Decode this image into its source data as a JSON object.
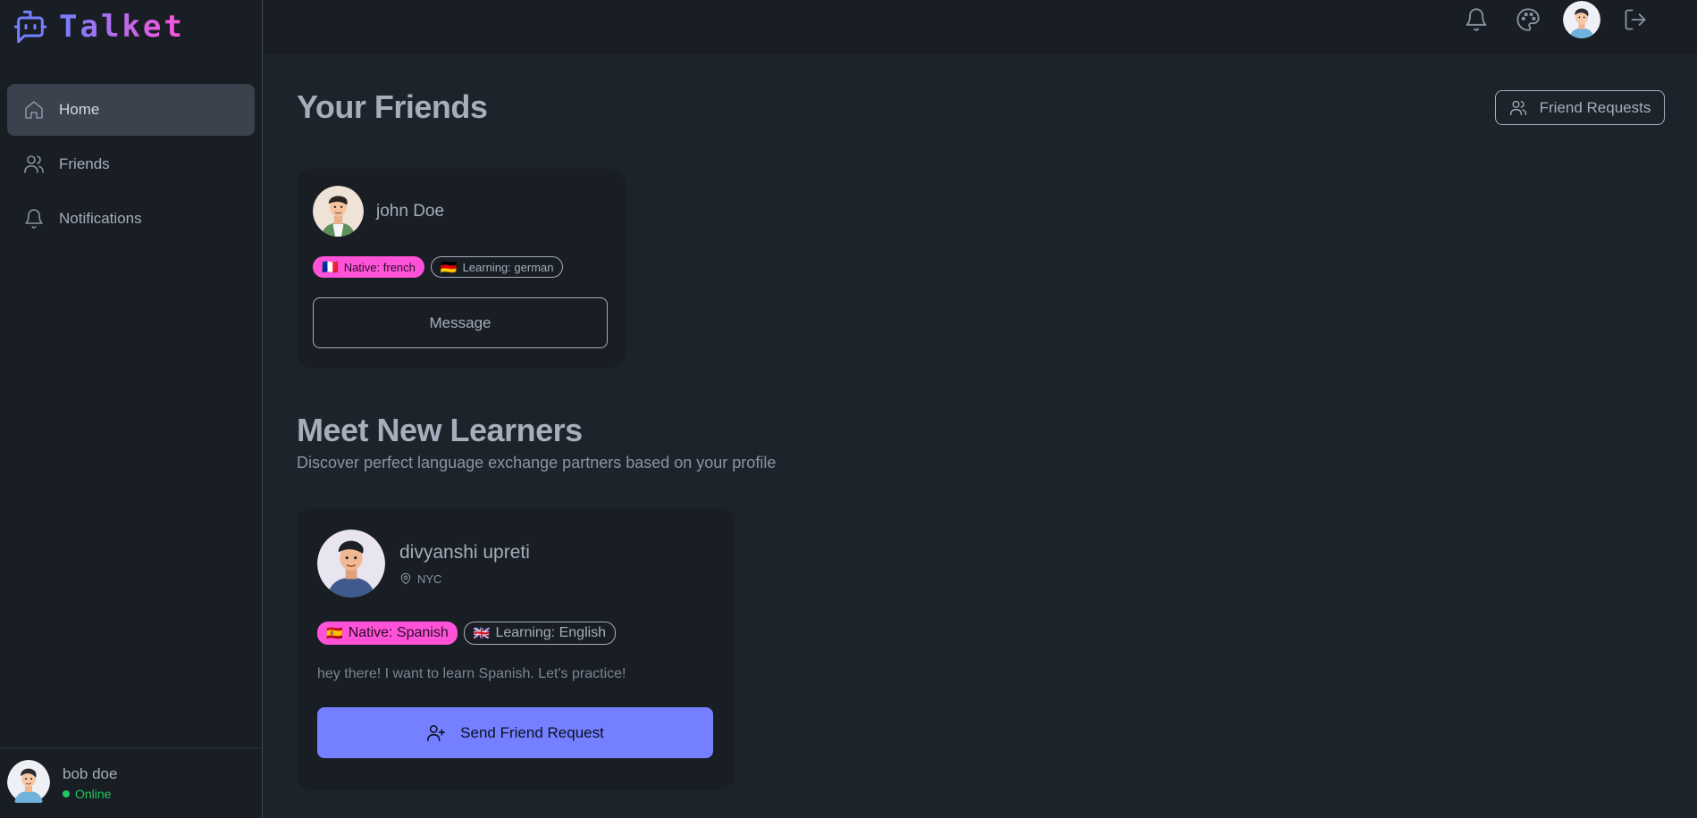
{
  "app": {
    "name": "Talket",
    "brand_color": "#7480ff"
  },
  "sidebar": {
    "items": [
      {
        "label": "Home",
        "icon": "home-icon"
      },
      {
        "label": "Friends",
        "icon": "users-icon"
      },
      {
        "label": "Notifications",
        "icon": "bell-icon"
      }
    ],
    "user": {
      "name": "bob doe",
      "status": "Online"
    }
  },
  "topbar": {
    "icons": [
      "bell-icon",
      "palette-icon",
      "avatar",
      "logout-icon"
    ]
  },
  "friends_section": {
    "title": "Your Friends",
    "requests_button": "Friend Requests",
    "friends": [
      {
        "name": "john Doe",
        "native": "Native: french",
        "native_flag": "🇫🇷",
        "learning": "Learning: german",
        "learning_flag": "🇩🇪",
        "button": "Message"
      }
    ]
  },
  "learners_section": {
    "title": "Meet New Learners",
    "subtitle": "Discover perfect language exchange partners based on your profile",
    "learners": [
      {
        "name": "divyanshi upreti",
        "location": "NYC",
        "native": "Native: Spanish",
        "native_flag": "🇪🇸",
        "learning": "Learning: English",
        "learning_flag": "🇬🇧",
        "bio": "hey there! I want to learn Spanish. Let's practice!",
        "button": "Send Friend Request"
      }
    ]
  }
}
